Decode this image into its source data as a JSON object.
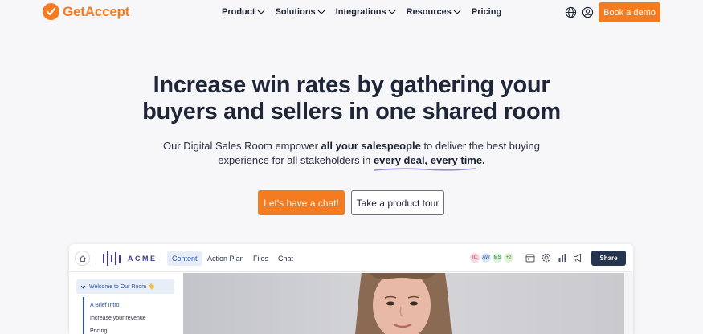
{
  "brand": {
    "name": "GetAccept",
    "accent": "#f47b20"
  },
  "nav": {
    "items": [
      {
        "label": "Product",
        "dropdown": true
      },
      {
        "label": "Solutions",
        "dropdown": true
      },
      {
        "label": "Integrations",
        "dropdown": true
      },
      {
        "label": "Resources",
        "dropdown": true
      },
      {
        "label": "Pricing",
        "dropdown": false
      }
    ],
    "icons": [
      "globe-icon",
      "user-icon"
    ],
    "cta_label": "Book a demo"
  },
  "hero": {
    "title_line1": "Increase win rates by gathering your",
    "title_line2": "buyers and sellers in one shared room",
    "sub_part1": "Our Digital Sales Room empower ",
    "sub_bold1": "all your salespeople",
    "sub_part2": " to deliver the best buying experience for all stakeholders in ",
    "sub_bold2": "every deal, every time.",
    "cta_primary": "Let's have a chat!",
    "cta_secondary": "Take a product tour"
  },
  "app_preview": {
    "company": "ACME",
    "tabs": [
      {
        "label": "Content",
        "active": true
      },
      {
        "label": "Action Plan",
        "active": false
      },
      {
        "label": "Files",
        "active": false
      },
      {
        "label": "Chat",
        "active": false
      }
    ],
    "avatars": [
      {
        "initials": "IC",
        "color": "#f8d7de"
      },
      {
        "initials": "AW",
        "color": "#d8e8f7"
      },
      {
        "initials": "MS",
        "color": "#d9f0dc"
      },
      {
        "initials": "+2",
        "color": "#dff4d6"
      }
    ],
    "tool_icons": [
      "calendar-icon",
      "settings-icon",
      "analytics-icon",
      "megaphone-icon"
    ],
    "share_label": "Share",
    "sidebar": {
      "section_title": "Welcome to Our Room 👋",
      "items": [
        {
          "label": "A Brief Intro",
          "active": true
        },
        {
          "label": "Increase your revenue",
          "active": false
        },
        {
          "label": "Pricing",
          "active": false
        }
      ]
    }
  }
}
